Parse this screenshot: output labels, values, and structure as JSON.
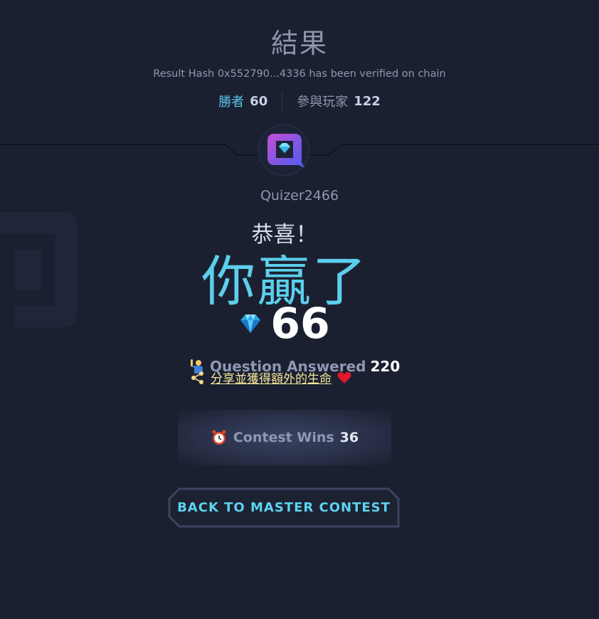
{
  "result": {
    "title": "結果",
    "hash_text": "Result Hash 0x552790...4336 has been verified on chain"
  },
  "stats": {
    "winners_label": "勝者",
    "winners_value": "60",
    "participants_label": "參與玩家",
    "participants_value": "122"
  },
  "user": {
    "avatar_icon": "quiz-logo-icon",
    "username": "Quizer2466"
  },
  "outcome": {
    "congrats": "恭喜！",
    "headline": "你贏了",
    "score_icon": "diamond-icon",
    "score": "66"
  },
  "questions": {
    "icon": "person-raising-hand-icon",
    "label": "Question Answered",
    "value": "220"
  },
  "share": {
    "icon": "share-icon",
    "label": "分享並獲得額外的生命",
    "heart_icon": "heart-icon"
  },
  "contest_wins": {
    "icon": "alarm-clock-icon",
    "label": "Contest Wins",
    "value": "36"
  },
  "back_button": {
    "label": "BACK TO MASTER CONTEST"
  },
  "colors": {
    "background": "#1b2031",
    "accent": "#5ccfec",
    "share_link": "#f4e59a",
    "muted": "#8f98b1"
  }
}
